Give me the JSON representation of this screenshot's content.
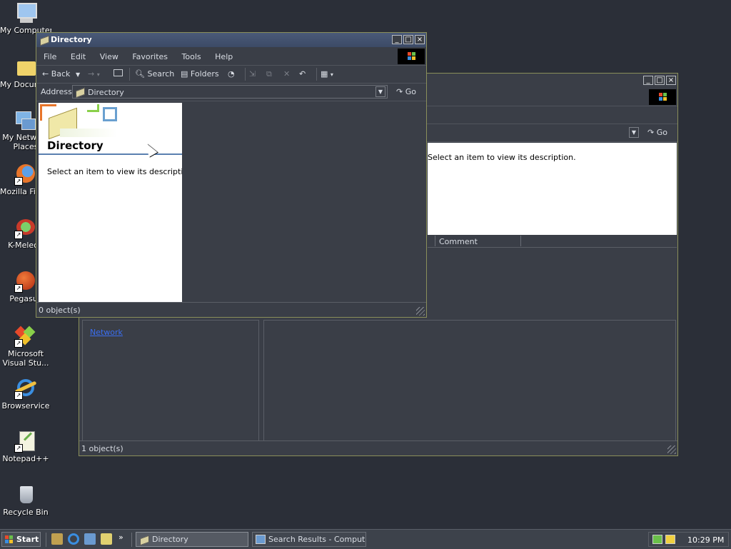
{
  "desktop": {
    "icons": [
      {
        "label": "My Computer"
      },
      {
        "label": "My Documents"
      },
      {
        "label": "My Network Places"
      },
      {
        "label": "Mozilla Firefox"
      },
      {
        "label": "K-Meleon"
      },
      {
        "label": "Pegasus"
      },
      {
        "label": "Microsoft Visual Stu..."
      },
      {
        "label": "Browservice"
      },
      {
        "label": "Notepad++"
      },
      {
        "label": "Recycle Bin"
      }
    ]
  },
  "back_window": {
    "go_label": "Go",
    "description": "Select an item to view its description.",
    "column_comment": "Comment",
    "link_text": "Network",
    "status": "1 object(s)"
  },
  "front_window": {
    "title": "Directory",
    "menu": [
      "File",
      "Edit",
      "View",
      "Favorites",
      "Tools",
      "Help"
    ],
    "toolbar": {
      "back": "Back",
      "search": "Search",
      "folders": "Folders"
    },
    "address_label": "Address",
    "address_value": "Directory",
    "go_label": "Go",
    "panel_title": "Directory",
    "panel_description": "Select an item to view its description.",
    "status": "0 object(s)"
  },
  "taskbar": {
    "start_label": "Start",
    "tasks": [
      {
        "label": "Directory",
        "active": true
      },
      {
        "label": "Search Results - Computers",
        "active": false
      }
    ],
    "clock": "10:29 PM"
  },
  "colors": {
    "desktop": "#2b2f38",
    "titlebar": "#4a5a78",
    "window_border": "#8a8f5a"
  }
}
